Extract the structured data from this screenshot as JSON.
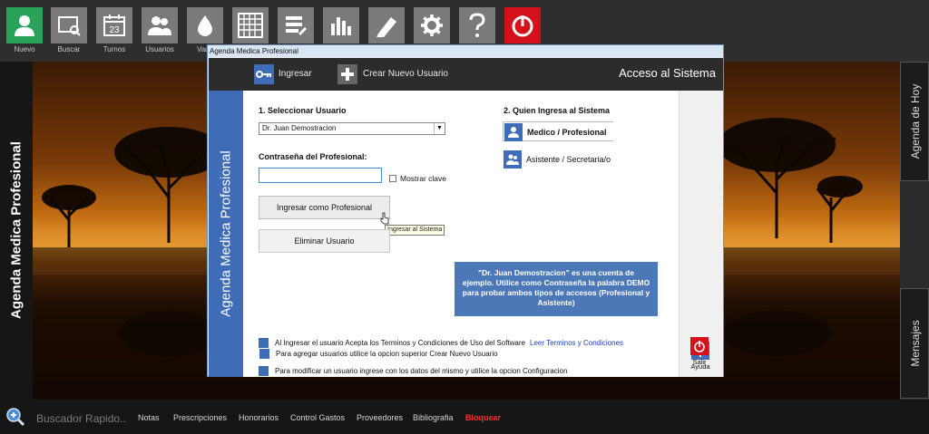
{
  "toolbar": {
    "items": [
      {
        "label": "Nuevo",
        "icon": "user-icon"
      },
      {
        "label": "Buscar",
        "icon": "search-window-icon"
      },
      {
        "label": "Turnos",
        "icon": "calendar-icon",
        "badge": "23"
      },
      {
        "label": "Usuarios",
        "icon": "users-icon"
      },
      {
        "label": "Vade",
        "icon": "drop-icon"
      },
      {
        "label": "",
        "icon": "grid-icon"
      },
      {
        "label": "",
        "icon": "list-edit-icon"
      },
      {
        "label": "",
        "icon": "bar-chart-icon"
      },
      {
        "label": "",
        "icon": "pencil-icon"
      },
      {
        "label": "",
        "icon": "gear-icon"
      },
      {
        "label": "",
        "icon": "question-icon"
      },
      {
        "label": "",
        "icon": "power-icon"
      }
    ]
  },
  "left_panel": {
    "title": "Agenda Medica Profesional"
  },
  "right_tabs": {
    "agenda": "Agenda de Hoy",
    "mensajes": "Mensajes"
  },
  "bottom_bar": {
    "search_placeholder": "Buscador Rapido..",
    "links": [
      "Notas",
      "Prescripciones",
      "Honorarios",
      "Control Gastos",
      "Proveedores",
      "Bibliografia",
      "Bloquear"
    ]
  },
  "dialog": {
    "window_title": "Agenda Medica Profesional",
    "header": {
      "login_label": "Ingresar",
      "new_user_label": "Crear Nuevo Usuario",
      "title": "Acceso al Sistema"
    },
    "side_title": "Agenda Medica Profesional",
    "step1_label": "1. Seleccionar Usuario",
    "selected_user": "Dr. Juan Demostracion",
    "password_label": "Contraseña del Profesional:",
    "password_value": "",
    "show_password_label": "Mostrar clave",
    "login_pro_button": "Ingresar como Profesional",
    "tooltip": "Ingresar al Sistema",
    "delete_user_button": "Eliminar Usuario",
    "step2_label": "2. Quien Ingresa al Sistema",
    "roles": {
      "pro": "Medico / Profesional",
      "assistant": "Asistente / Secretaria/o"
    },
    "info_text": "\"Dr. Juan Demostracion\" es una cuenta de ejemplo. Utilice como Contraseña la palabra DEMO para probar ambos tipos de accesos (Profesional y Asistente)",
    "notes": [
      {
        "text": "Al Ingresar el usuario Acepta los Terminos y Condiciones de Uso del Software",
        "link": "Leer Terminos y Condiciones"
      },
      {
        "text": "Para modificar un usuario ingrese con los datos del mismo y utilice la opcion Configuracion",
        "link": ""
      },
      {
        "text": "Para agregar usuarios utilice la opcion superior Crear Nuevo Usuario",
        "link": ""
      }
    ],
    "side_buttons": {
      "help": "Ayuda",
      "exit": "Salir"
    }
  },
  "colors": {
    "accent_blue": "#3f6cb6",
    "info_blue": "#4c78b8",
    "green": "#29a35a",
    "red": "#d5121b"
  }
}
